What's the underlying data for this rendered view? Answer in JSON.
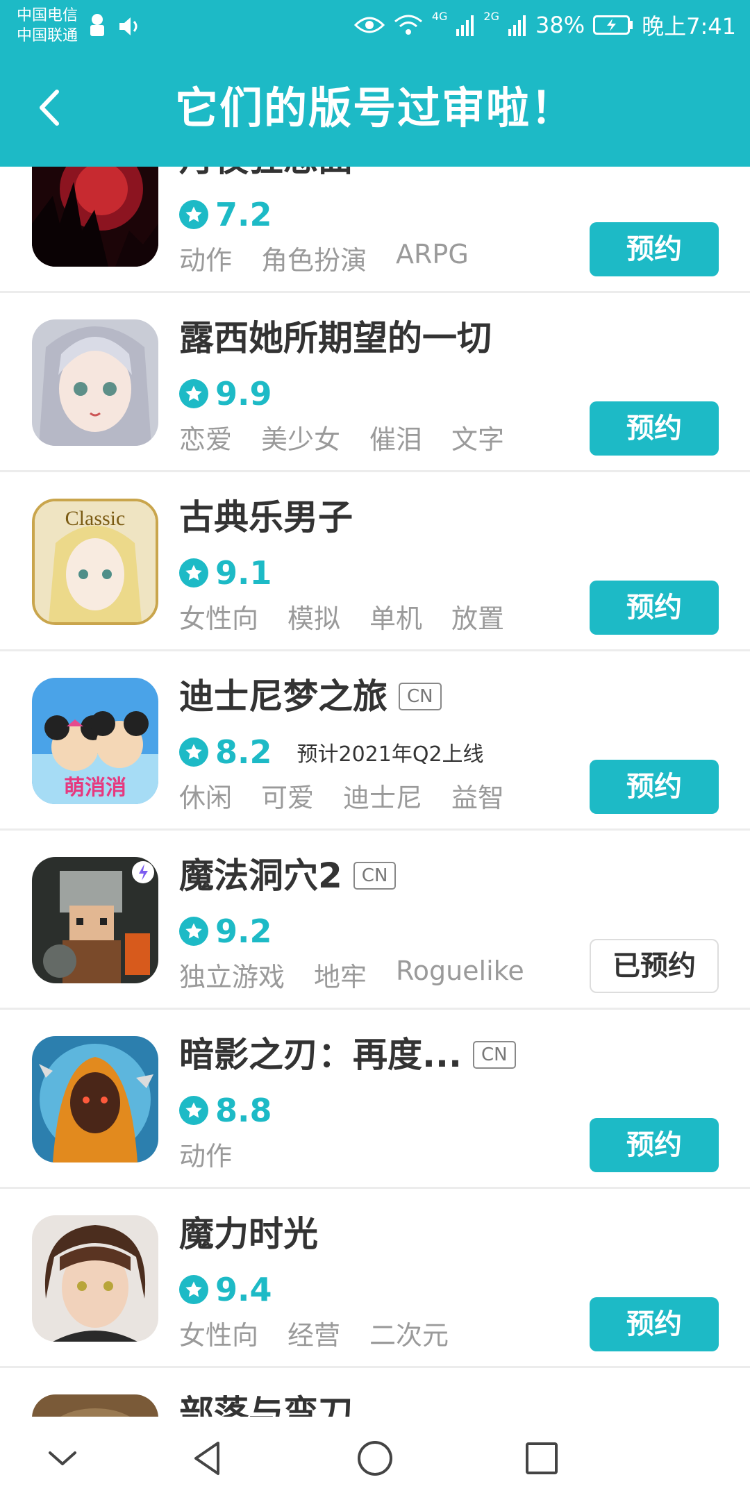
{
  "status_bar": {
    "carrier1": "中国电信",
    "carrier2": "中国联通",
    "net1": "4G",
    "net2": "2G",
    "battery": "38%",
    "time": "晚上7:41"
  },
  "header": {
    "title": "它们的版号过审啦！",
    "back_icon": "chevron-left-icon"
  },
  "colors": {
    "accent": "#1dbac6",
    "text": "#333333",
    "tag": "#9a9a9a"
  },
  "games": [
    {
      "title": "月夜狂想曲",
      "badge": "",
      "rating": "7.2",
      "release": "",
      "tags": [
        "动作",
        "角色扮演",
        "ARPG"
      ],
      "button": "预约",
      "reserved": false
    },
    {
      "title": "露西她所期望的一切",
      "badge": "",
      "rating": "9.9",
      "release": "",
      "tags": [
        "恋爱",
        "美少女",
        "催泪",
        "文字"
      ],
      "button": "预约",
      "reserved": false
    },
    {
      "title": "古典乐男子",
      "badge": "",
      "rating": "9.1",
      "release": "",
      "tags": [
        "女性向",
        "模拟",
        "单机",
        "放置"
      ],
      "button": "预约",
      "reserved": false,
      "icon_text": "Classic"
    },
    {
      "title": "迪士尼梦之旅",
      "badge": "CN",
      "rating": "8.2",
      "release": "预计2021年Q2上线",
      "tags": [
        "休闲",
        "可爱",
        "迪士尼",
        "益智"
      ],
      "button": "预约",
      "reserved": false,
      "icon_text": "萌消消"
    },
    {
      "title": "魔法洞穴2",
      "badge": "CN",
      "rating": "9.2",
      "release": "",
      "tags": [
        "独立游戏",
        "地牢",
        "Roguelike"
      ],
      "button": "已预约",
      "reserved": true
    },
    {
      "title": "暗影之刃：再度...",
      "badge": "CN",
      "rating": "8.8",
      "release": "",
      "tags": [
        "动作"
      ],
      "button": "预约",
      "reserved": false
    },
    {
      "title": "魔力时光",
      "badge": "",
      "rating": "9.4",
      "release": "",
      "tags": [
        "女性向",
        "经营",
        "二次元"
      ],
      "button": "预约",
      "reserved": false
    },
    {
      "title": "部落与弯刀",
      "badge": "",
      "rating": "",
      "release": "",
      "tags": [],
      "button": "",
      "reserved": false
    }
  ],
  "navbar": {
    "icons": [
      "chevron-down-icon",
      "back-triangle-icon",
      "home-circle-icon",
      "recents-square-icon"
    ]
  }
}
